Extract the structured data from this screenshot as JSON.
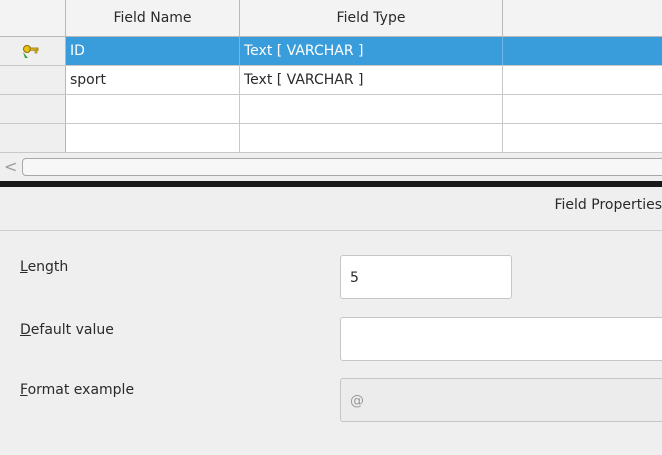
{
  "grid": {
    "headers": {
      "field_name": "Field Name",
      "field_type": "Field Type",
      "description": ""
    },
    "rows": [
      {
        "name": "ID",
        "type": "Text [ VARCHAR ]",
        "primary_key": true,
        "selected": true,
        "row_icon": "primary-key-icon"
      },
      {
        "name": "sport",
        "type": "Text [ VARCHAR ]",
        "primary_key": false,
        "selected": false
      },
      {
        "name": "",
        "type": "",
        "primary_key": false,
        "selected": false
      },
      {
        "name": "",
        "type": "",
        "primary_key": false,
        "selected": false
      }
    ]
  },
  "scrollbar": {
    "left_arrow": "<"
  },
  "properties": {
    "title": "Field Properties",
    "length": {
      "label_accel": "L",
      "label_rest": "ength",
      "value": "5"
    },
    "default_value": {
      "label_accel": "D",
      "label_rest": "efault value",
      "value": ""
    },
    "format_example": {
      "label_accel": "F",
      "label_rest": "ormat example",
      "value": "@"
    }
  },
  "colors": {
    "selection": "#399ddb",
    "panel_background": "#efefef",
    "splitter": "#1a1a1a"
  }
}
